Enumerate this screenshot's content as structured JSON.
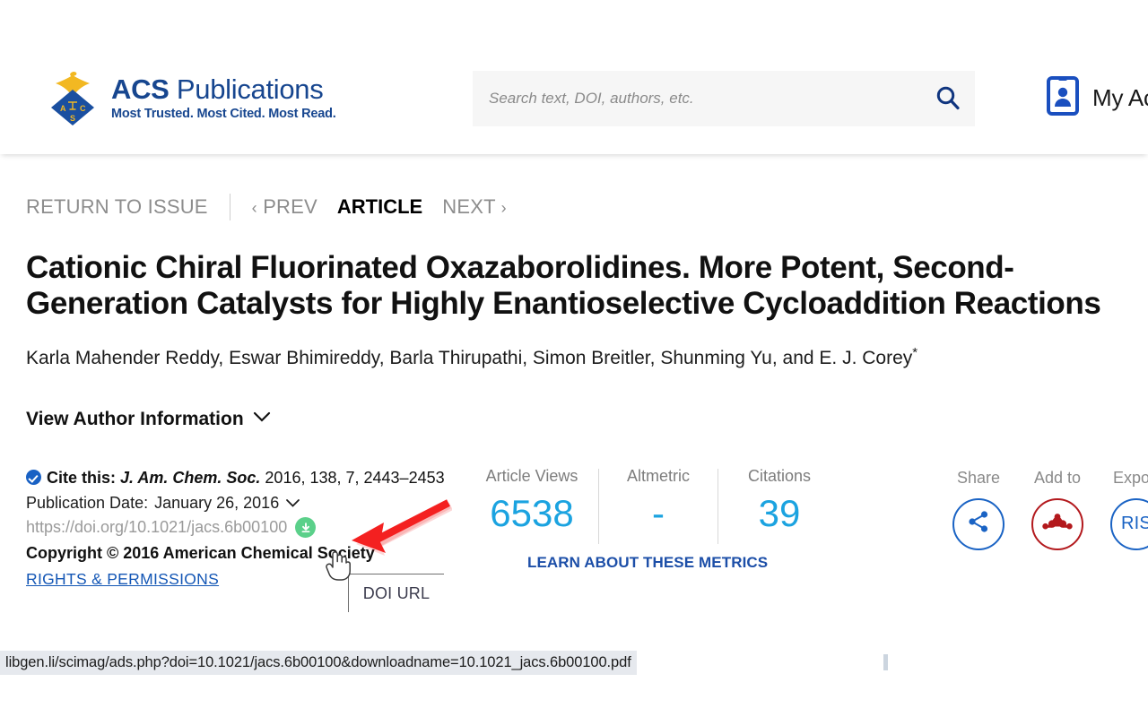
{
  "header": {
    "logo": {
      "brand_main": "ACS",
      "brand_sub": "Publications",
      "tagline": "Most Trusted. Most Cited. Most Read.",
      "mark_letters": [
        "A",
        "C",
        "S"
      ],
      "icon": "acs-diamond-eagle-logo",
      "brand_blue": "#17468f",
      "brand_gold": "#f2b822"
    },
    "search": {
      "placeholder": "Search text, DOI, authors, etc.",
      "value": "",
      "icon": "search-icon",
      "background": "#f6f6f6"
    },
    "account": {
      "label": "My Account",
      "icon": "id-badge-person-icon",
      "color": "#1a4fbf"
    }
  },
  "article_nav": {
    "return_label": "RETURN TO ISSUE",
    "prev_label": "PREV",
    "prev_icon": "chevron-left-icon",
    "current_label": "ARTICLE",
    "next_label": "NEXT",
    "next_icon": "chevron-right-icon"
  },
  "article": {
    "title": "Cationic Chiral Fluorinated Oxazaborolidines. More Potent, Second-Generation Catalysts for Highly Enantioselective Cycloaddition Reactions",
    "authors": "Karla Mahender Reddy, Eswar Bhimireddy, Barla Thirupathi, Simon Breitler, Shunming Yu, and E. J. Corey",
    "corresponding_marker": "*",
    "author_information_label": "View Author Information",
    "author_information_icon": "chevron-down-icon"
  },
  "citation": {
    "badge_icon": "verified-check-icon",
    "cite_label": "Cite this:",
    "journal": "J. Am. Chem. Soc.",
    "details": "2016, 138, 7, 2443–2453",
    "publication_date_label": "Publication Date:",
    "publication_date": "January 26, 2016",
    "publication_date_icon": "chevron-down-icon",
    "doi_url": "https://doi.org/10.1021/jacs.6b00100",
    "download_icon": "download-circle-icon",
    "download_color": "#5bd08a",
    "copyright": "Copyright © 2016 American Chemical Society",
    "rights_link": "RIGHTS & PERMISSIONS"
  },
  "tooltip": {
    "text": "DOI URL"
  },
  "annotation": {
    "arrow_icon": "red-arrow-pointer",
    "arrow_color": "#f42020"
  },
  "cursor": {
    "icon": "pointing-hand-cursor"
  },
  "metrics": {
    "items": [
      {
        "label": "Article Views",
        "value": "6538"
      },
      {
        "label": "Altmetric",
        "value": "-"
      },
      {
        "label": "Citations",
        "value": "39"
      }
    ],
    "value_color": "#1ba3e0",
    "learn_link": "LEARN ABOUT THESE METRICS",
    "learn_color": "#1d4fa8"
  },
  "actions": [
    {
      "label": "Share",
      "icon": "share-nodes-icon",
      "color": "#1a63c4",
      "text": ""
    },
    {
      "label": "Add to",
      "icon": "mendeley-icon",
      "color": "#b3191d",
      "text": ""
    },
    {
      "label": "Export",
      "icon": "ris-export-icon",
      "color": "#1a63c4",
      "text": "RIS"
    }
  ],
  "status_bar": {
    "url": "libgen.li/scimag/ads.php?doi=10.1021/jacs.6b00100&downloadname=10.1021_jacs.6b00100.pdf"
  }
}
